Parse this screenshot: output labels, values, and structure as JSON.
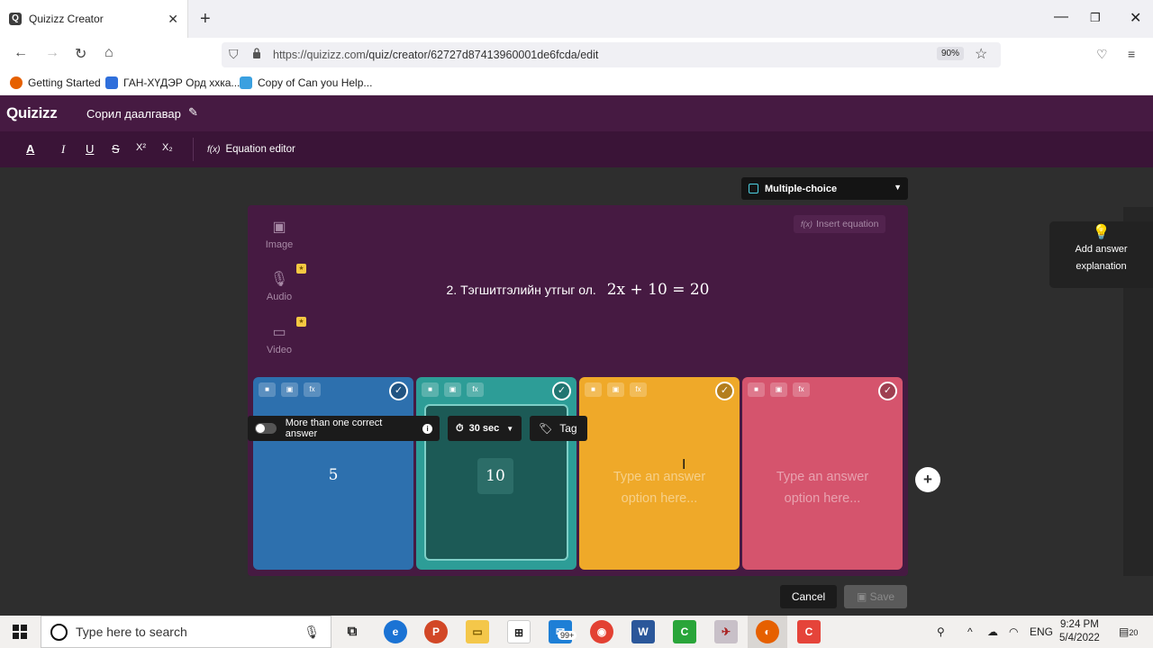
{
  "browser": {
    "tab_title": "Quizizz Creator",
    "tab_favicon": "Q",
    "url_host": "https://quizizz.com",
    "url_path": "/quiz/creator/62727d87413960001de6fcda/edit",
    "zoom": "90%",
    "bookmarks": [
      {
        "label": "Getting Started",
        "icon": "firefox-icon",
        "color": "#e66000"
      },
      {
        "label": "ГАН-ХҮДЭР Орд ххка...",
        "icon": "docs-icon",
        "color": "#2f6fdb"
      },
      {
        "label": "Copy of Can you Help...",
        "icon": "slides-icon",
        "color": "#3aa0e0"
      }
    ]
  },
  "app": {
    "logo": "Quizizz",
    "quiz_title": "Сорил даалгавар",
    "toolbar": {
      "text_color": "A",
      "italic": "I",
      "underline": "U",
      "strike": "S",
      "superscript": "X²",
      "subscript": "X₂",
      "equation_editor": "Equation editor",
      "fx": "f(x)"
    },
    "question_type": "Multiple-choice",
    "insert_equation": "Insert equation",
    "media": {
      "image": "Image",
      "audio": "Audio",
      "video": "Video"
    },
    "question": {
      "text": "2. Тэгшитгэлийн утгыг ол.",
      "math": "2x + 10 = 20"
    },
    "answers": [
      {
        "value": "5",
        "color": "#2d70ae"
      },
      {
        "value": "10",
        "color": "#2d9d97"
      },
      {
        "placeholder": "Type an answer option here...",
        "color": "#efa929"
      },
      {
        "placeholder": "Type an answer option here...",
        "color": "#d5546d"
      }
    ],
    "explanation_label": "Add answer explanation",
    "bottom": {
      "multi_correct": "More than one correct answer",
      "timer": "30 sec",
      "tag": "Tag",
      "cancel": "Cancel",
      "save": "Save"
    }
  },
  "taskbar": {
    "search_placeholder": "Type here to search",
    "mail_badge": "99+",
    "language": "ENG",
    "time": "9:24 PM",
    "date": "5/4/2022",
    "notifications": "20"
  }
}
